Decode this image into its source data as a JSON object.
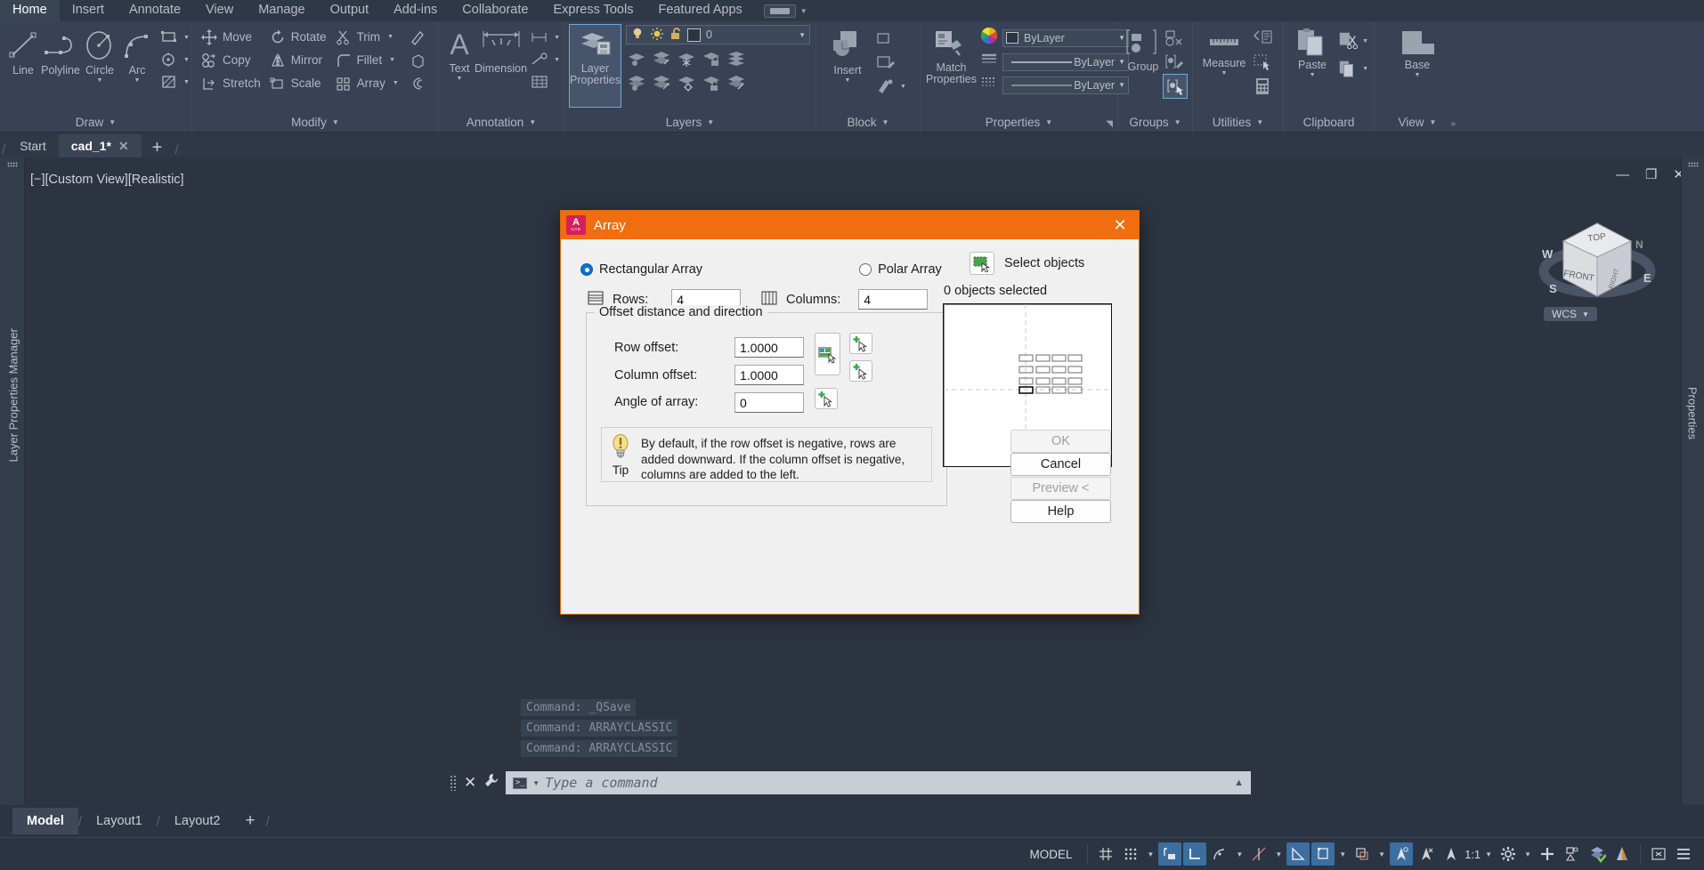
{
  "app": {
    "title": "AutoCAD",
    "accent_orange": "#f06e10",
    "accent_blue": "#3c6e9f",
    "ribbon_bg": "#394254",
    "canvas_bg": "#2c3441"
  },
  "ribbon": {
    "tabs": [
      {
        "label": "Home",
        "active": true
      },
      {
        "label": "Insert",
        "active": false
      },
      {
        "label": "Annotate",
        "active": false
      },
      {
        "label": "View",
        "active": false
      },
      {
        "label": "Manage",
        "active": false
      },
      {
        "label": "Output",
        "active": false
      },
      {
        "label": "Add-ins",
        "active": false
      },
      {
        "label": "Collaborate",
        "active": false
      },
      {
        "label": "Express Tools",
        "active": false
      },
      {
        "label": "Featured Apps",
        "active": false
      }
    ],
    "panels": {
      "draw": {
        "title": "Draw",
        "big": [
          {
            "label": "Line",
            "icon": "line-icon"
          },
          {
            "label": "Polyline",
            "icon": "polyline-icon"
          },
          {
            "label": "Circle",
            "icon": "circle-icon",
            "caret": true
          },
          {
            "label": "Arc",
            "icon": "arc-icon",
            "caret": true
          }
        ],
        "small": [
          "rectangle-icon",
          "center-mark-icon",
          "hatch-icon"
        ]
      },
      "modify": {
        "title": "Modify",
        "items": [
          {
            "label": "Move",
            "icon": "move-icon"
          },
          {
            "label": "Rotate",
            "icon": "rotate-icon"
          },
          {
            "label": "Trim",
            "icon": "trim-icon",
            "caret": true
          },
          {
            "label": "Copy",
            "icon": "copy-icon"
          },
          {
            "label": "Mirror",
            "icon": "mirror-icon"
          },
          {
            "label": "Fillet",
            "icon": "fillet-icon",
            "caret": true
          },
          {
            "label": "Stretch",
            "icon": "stretch-icon"
          },
          {
            "label": "Scale",
            "icon": "scale-icon"
          },
          {
            "label": "Array",
            "icon": "array-icon",
            "caret": true
          }
        ],
        "extra_icons": [
          "erase-icon",
          "explode-icon",
          "offset-icon"
        ]
      },
      "annotation": {
        "title": "Annotation",
        "big": [
          {
            "label": "Text",
            "icon": "text-icon",
            "caret": true
          },
          {
            "label": "Dimension",
            "icon": "dimension-icon"
          }
        ],
        "small": [
          "linear-dimension-icon",
          "leader-icon",
          "table-icon"
        ]
      },
      "layers": {
        "title": "Layers",
        "main_button": "Layer\nProperties",
        "main_button_line1": "Layer",
        "main_button_line2": "Properties",
        "current_layer": "0",
        "layer_state_icons": [
          "lightbulb-on-icon",
          "sun-icon",
          "unlock-icon"
        ],
        "grid_icons": [
          "layer-off-icon",
          "layer-isolate-icon",
          "layer-freeze-icon",
          "layer-lock-icon",
          "layer-merge-icon",
          "layer-on-icon",
          "layer-unisolate-icon",
          "layer-thaw-icon",
          "layer-unlock-icon",
          "layer-delete-icon"
        ]
      },
      "block": {
        "title": "Block",
        "big": [
          {
            "label": "Insert",
            "icon": "insert-block-icon",
            "caret": true
          }
        ],
        "small": [
          "create-block-icon",
          "edit-block-icon",
          "define-attribute-icon"
        ]
      },
      "properties": {
        "title": "Properties",
        "big": [
          {
            "label": "Match\nProperties",
            "line1": "Match",
            "line2": "Properties",
            "icon": "match-properties-icon"
          }
        ],
        "color_value": "ByLayer",
        "linetype_value": "ByLayer",
        "lineweight_value": "ByLayer",
        "has_dialog_launcher": true
      },
      "groups": {
        "title": "Groups",
        "big": [
          {
            "label": "Group",
            "icon": "group-icon"
          }
        ],
        "small": [
          "ungroup-icon",
          "group-edit-icon",
          "group-selection-icon"
        ]
      },
      "utilities": {
        "title": "Utilities",
        "big": [
          {
            "label": "Measure",
            "icon": "measure-icon",
            "caret": true
          }
        ],
        "small": [
          "quick-select-icon",
          "quick-calc-icon",
          "point-style-icon"
        ]
      },
      "clipboard": {
        "title": "Clipboard",
        "big": [
          {
            "label": "Paste",
            "icon": "paste-icon",
            "caret": true
          }
        ],
        "small": [
          "cut-icon",
          "copy-clip-icon"
        ]
      },
      "view": {
        "title": "View",
        "big": [
          {
            "label": "Base",
            "icon": "base-view-icon",
            "caret": true
          }
        ],
        "overflow": "»"
      }
    }
  },
  "file_tabs": {
    "items": [
      {
        "label": "Start",
        "active": false,
        "closable": false
      },
      {
        "label": "cad_1*",
        "active": true,
        "closable": true
      }
    ],
    "new_tab_label": "+"
  },
  "viewport": {
    "label": "[−][Custom View][Realistic]",
    "minimize": "—",
    "restore": "❐",
    "close": "✕",
    "viewcube": {
      "top": "TOP",
      "front": "FRONT",
      "right": "RIGHT",
      "north": "N",
      "south": "S",
      "east": "E",
      "west": "W",
      "wcs_label": "WCS"
    }
  },
  "left_panel": {
    "title": "Layer Properties Manager"
  },
  "right_panel": {
    "title": "Properties"
  },
  "command_window": {
    "history": [
      "Command: _QSave",
      "Command: ARRAYCLASSIC",
      "Command: ARRAYCLASSIC"
    ],
    "placeholder": "Type a command",
    "close_label": "✕",
    "customize_label": "🔧"
  },
  "layout_tabs": {
    "items": [
      {
        "label": "Model",
        "active": true
      },
      {
        "label": "Layout1",
        "active": false
      },
      {
        "label": "Layout2",
        "active": false
      }
    ],
    "add_label": "+"
  },
  "status_bar": {
    "space_label": "MODEL",
    "scale": "1:1",
    "buttons": [
      {
        "name": "grid-display-icon",
        "on": false
      },
      {
        "name": "snap-mode-icon",
        "on": false
      },
      {
        "name": "infer-constraints-icon",
        "on": true
      },
      {
        "name": "ortho-mode-icon",
        "on": true
      },
      {
        "name": "polar-tracking-icon",
        "on": false
      },
      {
        "name": "isometric-drafting-icon",
        "on": false
      },
      {
        "name": "object-snap-tracking-icon",
        "on": true
      },
      {
        "name": "object-snap-icon",
        "on": true
      },
      {
        "name": "lineweight-icon",
        "on": false
      },
      {
        "name": "transparency-icon",
        "on": true
      },
      {
        "name": "selection-cycling-icon",
        "on": false
      },
      {
        "name": "dynamic-ucs-icon",
        "on": false
      },
      {
        "name": "annotation-visibility-icon",
        "on": false
      },
      {
        "name": "autoscale-icon",
        "on": false
      },
      {
        "name": "workspace-switching-icon",
        "on": false
      },
      {
        "name": "annotation-monitor-icon",
        "on": false
      },
      {
        "name": "units-icon",
        "on": false
      },
      {
        "name": "isolate-objects-icon",
        "on": false
      },
      {
        "name": "hardware-acceleration-icon",
        "on": false
      },
      {
        "name": "clean-screen-icon",
        "on": false
      },
      {
        "name": "customization-icon",
        "on": false
      }
    ]
  },
  "dialog": {
    "title": "Array",
    "close_label": "✕",
    "array_type": {
      "rectangular": "Rectangular Array",
      "polar": "Polar Array",
      "selected": "rectangular"
    },
    "rows": {
      "label": "Rows:",
      "value": "4"
    },
    "columns": {
      "label": "Columns:",
      "value": "4"
    },
    "offset_group": {
      "legend": "Offset distance and direction",
      "row_offset": {
        "label": "Row offset:",
        "value": "1.0000"
      },
      "column_offset": {
        "label": "Column offset:",
        "value": "1.0000"
      },
      "angle_of_array": {
        "label": "Angle of array:",
        "value": "0"
      }
    },
    "tip": {
      "label": "Tip",
      "text": "By default, if the row offset is negative, rows are added downward.  If the column offset is negative, columns are added to the left."
    },
    "selection": {
      "button_label": "Select objects",
      "count_text": "0 objects selected"
    },
    "buttons": [
      {
        "label": "OK",
        "enabled": false
      },
      {
        "label": "Cancel",
        "enabled": true
      },
      {
        "label": "Preview <",
        "enabled": false
      },
      {
        "label": "Help",
        "enabled": true
      }
    ],
    "preview": {
      "rows": 4,
      "columns": 4
    }
  }
}
